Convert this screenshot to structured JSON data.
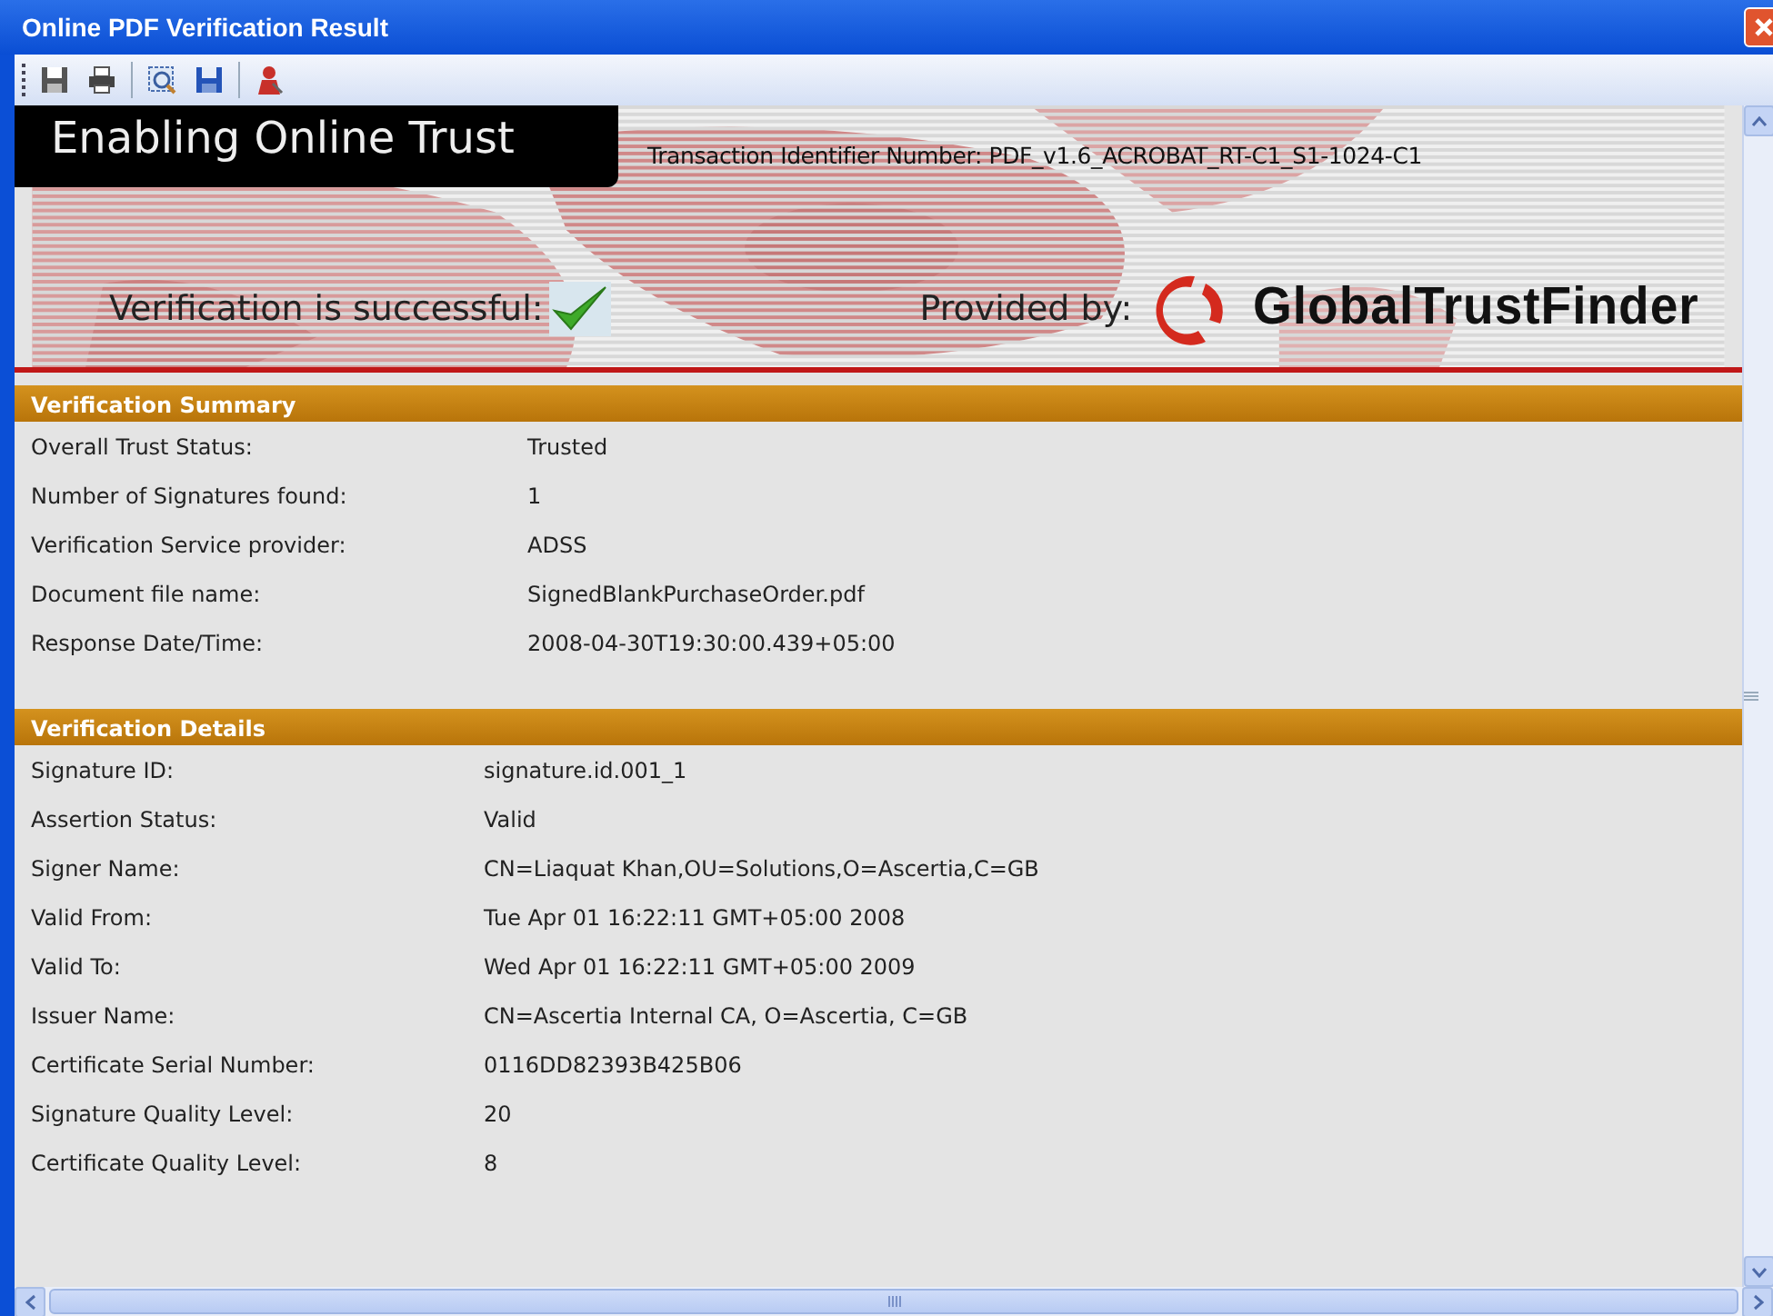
{
  "window": {
    "title": "Online PDF Verification Result"
  },
  "banner": {
    "tagline": "Enabling Online Trust",
    "transaction": "Transaction Identifier Number: PDF_v1.6_ACROBAT_RT-C1_S1-1024-C1",
    "verification": "Verification is successful:",
    "verified": true,
    "provided_by": "Provided by:",
    "brand": "GlobalTrustFinder"
  },
  "sections": [
    {
      "title": "Verification Summary",
      "rows": [
        {
          "label": "Overall Trust Status:",
          "value": "Trusted"
        },
        {
          "label": "Number of Signatures found:",
          "value": "1"
        },
        {
          "label": "Verification Service provider:",
          "value": "ADSS"
        },
        {
          "label": "Document file name:",
          "value": "SignedBlankPurchaseOrder.pdf"
        },
        {
          "label": "Response Date/Time:",
          "value": "2008-04-30T19:30:00.439+05:00"
        }
      ]
    },
    {
      "title": "Verification Details",
      "rows": [
        {
          "label": "Signature ID:",
          "value": "signature.id.001_1"
        },
        {
          "label": "Assertion Status:",
          "value": "Valid"
        },
        {
          "label": "Signer Name:",
          "value": "CN=Liaquat Khan,OU=Solutions,O=Ascertia,C=GB"
        },
        {
          "label": "Valid From:",
          "value": "Tue Apr 01 16:22:11 GMT+05:00 2008"
        },
        {
          "label": "Valid To:",
          "value": "Wed Apr 01 16:22:11 GMT+05:00 2009"
        },
        {
          "label": "Issuer Name:",
          "value": "CN=Ascertia Internal CA, O=Ascertia, C=GB"
        },
        {
          "label": "Certificate Serial Number:",
          "value": "0116DD82393B425B06"
        },
        {
          "label": "Signature Quality Level:",
          "value": "20"
        },
        {
          "label": "Certificate Quality Level:",
          "value": "8"
        }
      ]
    }
  ]
}
